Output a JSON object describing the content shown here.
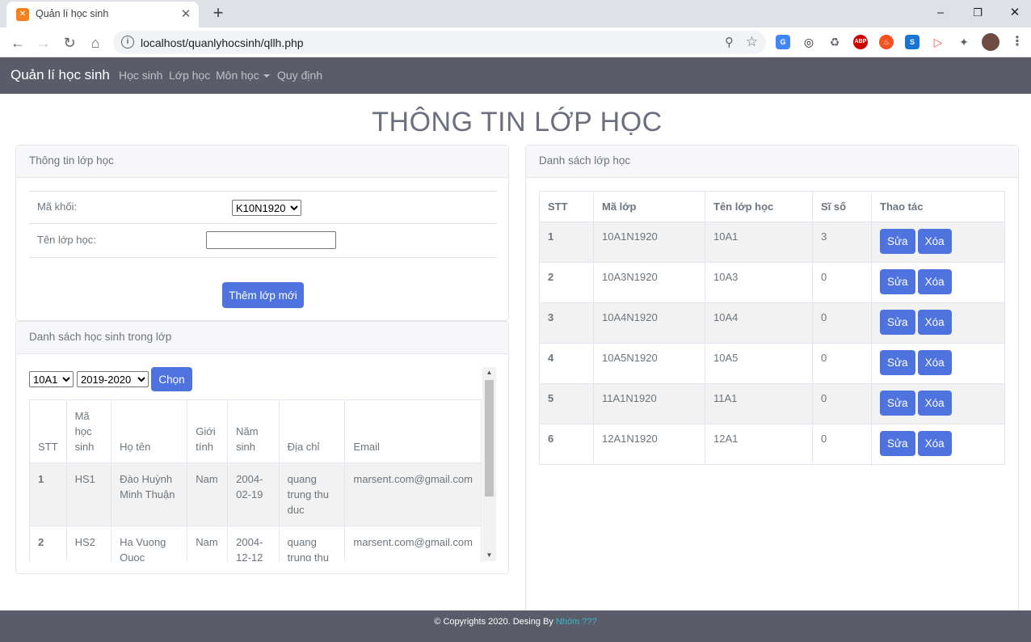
{
  "browser": {
    "tab_title": "Quản lí học sinh",
    "url": "localhost/quanlyhocsinh/qllh.php"
  },
  "nav": {
    "brand": "Quản lí học sinh",
    "links": [
      "Học sinh",
      "Lớp học",
      "Môn học",
      "Quy định"
    ]
  },
  "page_title": "THÔNG TIN LỚP HỌC",
  "class_info": {
    "header": "Thông tin lớp học",
    "grade_label": "Mã khối:",
    "grade_value": "K10N1920",
    "name_label": "Tên lớp học:",
    "name_value": "",
    "add_button": "Thêm lớp mới"
  },
  "students": {
    "header": "Danh sách học sinh trong lớp",
    "class_select": "10A1",
    "year_select": "2019-2020",
    "choose_button": "Chọn",
    "columns": [
      "STT",
      "Mã học sinh",
      "Họ tên",
      "Giới tính",
      "Năm sinh",
      "Địa chỉ",
      "Email"
    ],
    "rows": [
      [
        "1",
        "HS1",
        "Đào Huỳnh Minh Thuận",
        "Nam",
        "2004-02-19",
        "quang trung thu duc",
        "marsent.com@gmail.com"
      ],
      [
        "2",
        "HS2",
        "Ha Vuong Quoc",
        "Nam",
        "2004-12-12",
        "quang trung thu",
        "marsent.com@gmail.com"
      ]
    ]
  },
  "classes": {
    "header": "Danh sách lớp học",
    "columns": [
      "STT",
      "Mã lớp",
      "Tên lớp học",
      "Sĩ số",
      "Thao tác"
    ],
    "edit_label": "Sửa",
    "delete_label": "Xóa",
    "rows": [
      [
        "1",
        "10A1N1920",
        "10A1",
        "3"
      ],
      [
        "2",
        "10A3N1920",
        "10A3",
        "0"
      ],
      [
        "3",
        "10A4N1920",
        "10A4",
        "0"
      ],
      [
        "4",
        "10A5N1920",
        "10A5",
        "0"
      ],
      [
        "5",
        "11A1N1920",
        "11A1",
        "0"
      ],
      [
        "6",
        "12A1N1920",
        "12A1",
        "0"
      ]
    ]
  },
  "footer": {
    "text": "© Copyrights 2020. Desing By ",
    "link": "Nhóm ???"
  },
  "colors": {
    "navbar": "#5a5c69",
    "primary": "#4e73df",
    "footer_link": "#36b9cc"
  }
}
